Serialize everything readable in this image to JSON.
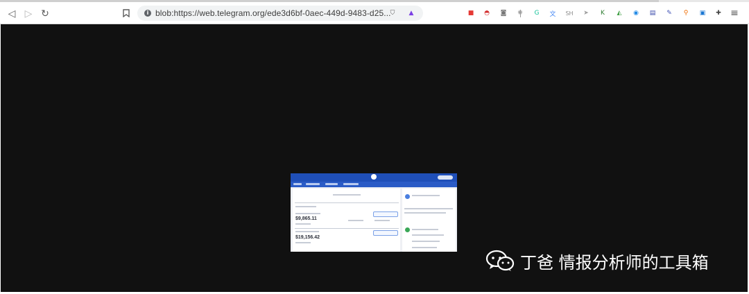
{
  "browser": {
    "url": "blob:https://web.telegram.org/ede3d6bf-0aec-449d-9483-d25...",
    "nav_icons": [
      "back-icon",
      "forward-icon",
      "reload-icon",
      "bookmark-icon"
    ],
    "extensions": [
      {
        "name": "brave-shield-icon",
        "glyph": "⛉",
        "color": "#5a5a5a"
      },
      {
        "name": "brave-rewards-icon",
        "glyph": "▲",
        "color": "#7b3fe4"
      },
      {
        "name": "extension-red-icon",
        "glyph": "■",
        "color": "#e53935"
      },
      {
        "name": "extension-pokeball-icon",
        "glyph": "◓",
        "color": "#d32f2f"
      },
      {
        "name": "extension-camera-icon",
        "glyph": "◙",
        "color": "#777777"
      },
      {
        "name": "extension-gear-icon",
        "glyph": "✺",
        "color": "#9e9e9e"
      },
      {
        "name": "extension-grammarly-icon",
        "glyph": "G",
        "color": "#15c39a"
      },
      {
        "name": "extension-translate-icon",
        "glyph": "文",
        "color": "#4285f4"
      },
      {
        "name": "extension-sh-icon",
        "glyph": "SH",
        "color": "#8a8a8a"
      },
      {
        "name": "extension-arrow-icon",
        "glyph": "➤",
        "color": "#9e9e9e"
      },
      {
        "name": "extension-k-icon",
        "glyph": "K",
        "color": "#2e7d32"
      },
      {
        "name": "extension-triangle-icon",
        "glyph": "◭",
        "color": "#43a047"
      },
      {
        "name": "extension-circle-icon",
        "glyph": "◉",
        "color": "#1e88e5"
      },
      {
        "name": "extension-whg-icon",
        "glyph": "▤",
        "color": "#3949ab"
      },
      {
        "name": "extension-clipper-icon",
        "glyph": "✎",
        "color": "#3f51b5"
      },
      {
        "name": "extension-search-icon",
        "glyph": "⚲",
        "color": "#ef6c00"
      },
      {
        "name": "extension-image-icon",
        "glyph": "▣",
        "color": "#1976d2"
      },
      {
        "name": "extensions-puzzle-icon",
        "glyph": "✚",
        "color": "#444444"
      },
      {
        "name": "menu-icon",
        "glyph": "≡",
        "color": "#555555"
      }
    ]
  },
  "thumbnail": {
    "balance_a": "$9,865.11",
    "balance_b": "$19,156.42"
  },
  "watermark": {
    "text": "丁爸 情报分析师的工具箱",
    "icon": "wechat-icon"
  }
}
